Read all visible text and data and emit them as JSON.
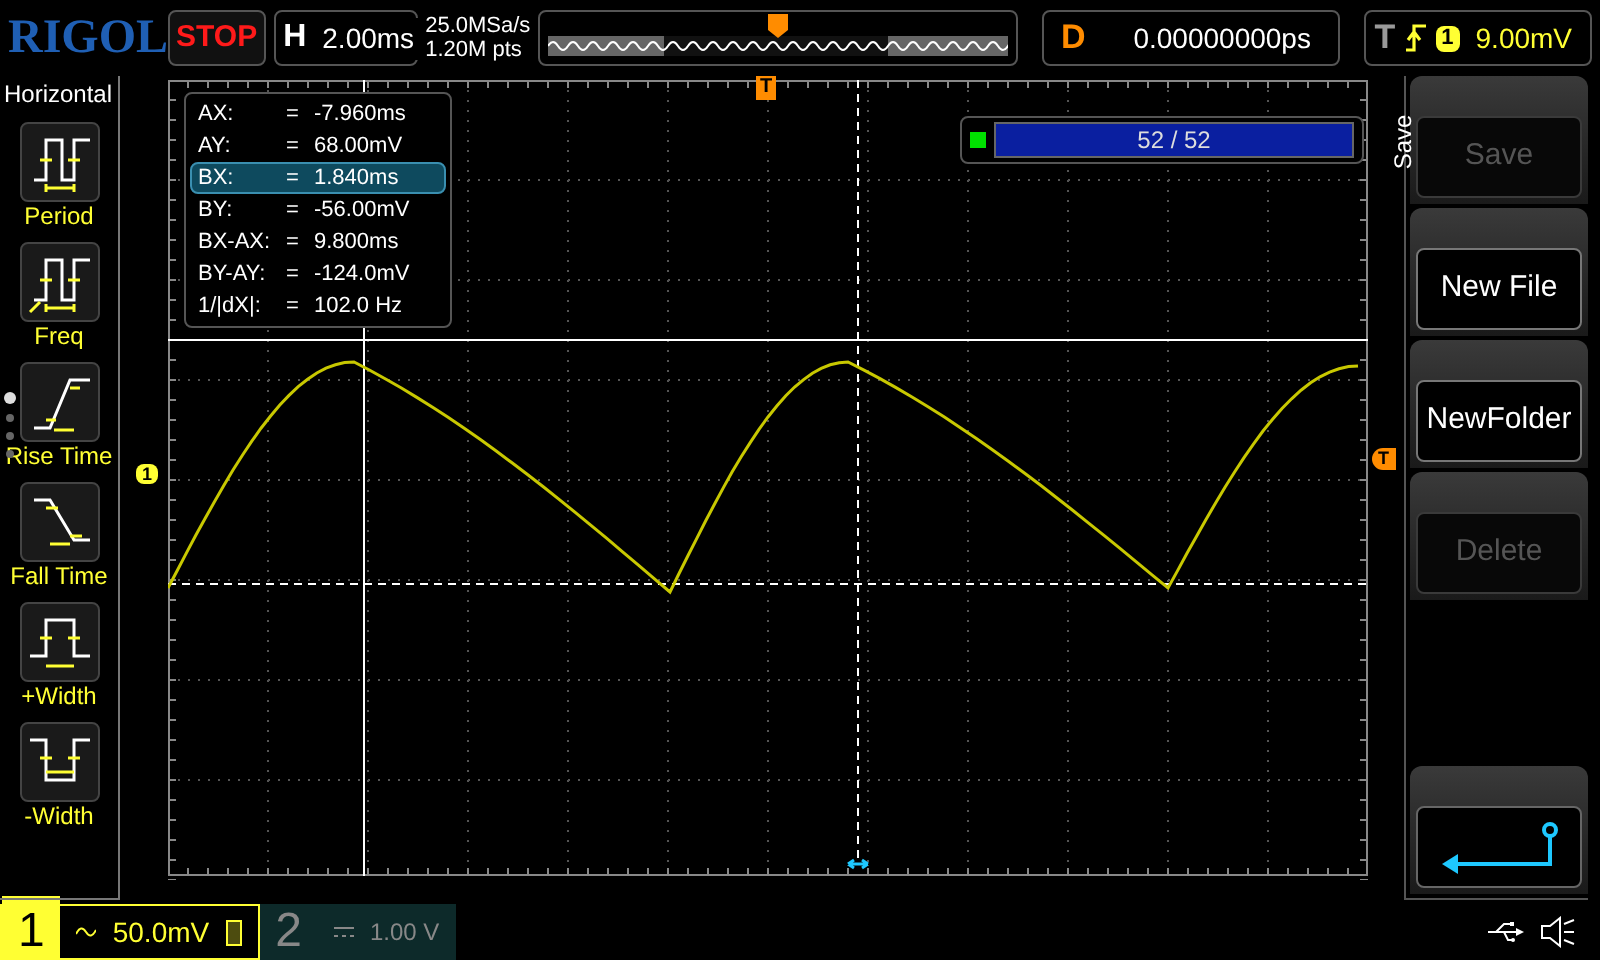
{
  "header": {
    "logo": "RIGOL",
    "run_state": "STOP",
    "timebase": {
      "label": "H",
      "value": "2.00ms"
    },
    "sample_rate": "25.0MSa/s",
    "memory_depth": "1.20M pts",
    "delay": {
      "label": "D",
      "value": "0.00000000ps"
    },
    "trigger": {
      "label": "T",
      "edge": {
        "kind": "rising"
      },
      "source": "1",
      "level": "9.00mV"
    }
  },
  "left_menu": {
    "title": "Horizontal",
    "items": [
      {
        "kind": "period",
        "label": "Period"
      },
      {
        "kind": "freq",
        "label": "Freq"
      },
      {
        "kind": "rise",
        "label": "Rise Time"
      },
      {
        "kind": "fall",
        "label": "Fall Time"
      },
      {
        "kind": "pwidth",
        "label": "+Width"
      },
      {
        "kind": "nwidth",
        "label": "-Width"
      }
    ],
    "pages": [
      {
        "selected": true
      },
      {
        "selected": false
      },
      {
        "selected": false
      },
      {
        "selected": false
      }
    ]
  },
  "cursor_readout": [
    {
      "label": "AX:",
      "eq": "=",
      "value": "-7.960ms",
      "selected": false
    },
    {
      "label": "AY:",
      "eq": "=",
      "value": "68.00mV",
      "selected": false
    },
    {
      "label": "BX:",
      "eq": "=",
      "value": "1.840ms",
      "selected": true
    },
    {
      "label": "BY:",
      "eq": "=",
      "value": "-56.00mV",
      "selected": false
    },
    {
      "label": "BX-AX:",
      "eq": "=",
      "value": "9.800ms",
      "selected": false
    },
    {
      "label": "BY-AY:",
      "eq": "=",
      "value": "-124.0mV",
      "selected": false
    },
    {
      "label": "1/|dX|:",
      "eq": "=",
      "value": "102.0 Hz",
      "selected": false
    }
  ],
  "markers": {
    "trigger_position": "T",
    "channel": "1",
    "trigger_level": "T"
  },
  "frame_counter": {
    "text": "52 / 52",
    "level": 1
  },
  "right_menu": {
    "title": "Save",
    "buttons": [
      {
        "kind": "text",
        "label": "Save",
        "disabled": true
      },
      {
        "kind": "text",
        "label": "New File",
        "disabled": false
      },
      {
        "kind": "text",
        "label": "NewFolder",
        "disabled": false
      },
      {
        "kind": "text",
        "label": "Delete",
        "disabled": true
      },
      {
        "kind": "spacer"
      },
      {
        "kind": "back"
      }
    ]
  },
  "channels": [
    {
      "number": "1",
      "coupling": {
        "kind": "ac"
      },
      "scale": "50.0mV",
      "active": true
    },
    {
      "number": "2",
      "coupling": {
        "kind": "dc"
      },
      "scale": "1.00 V",
      "active": false
    }
  ]
}
